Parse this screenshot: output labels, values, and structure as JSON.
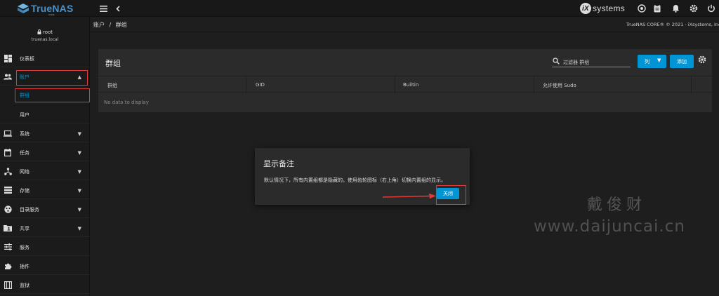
{
  "app": {
    "logo_text": "TrueNAS",
    "logo_sub": "CORE",
    "brand": "systems",
    "copyright": "TrueNAS CORE® © 2021 - iXsystems, Inc."
  },
  "icons": {
    "menu": "hamburger-menu-icon",
    "back": "chevron-left-icon",
    "topbar": [
      "truecommand-icon",
      "clipboard-icon",
      "bell-icon",
      "gear-icon",
      "power-icon"
    ]
  },
  "sidebar": {
    "user": "root",
    "host": "truenas.local",
    "items": [
      {
        "label": "仪表板",
        "icon": "dashboard-icon"
      },
      {
        "label": "账户",
        "icon": "accounts-icon",
        "expanded": true
      },
      {
        "label": "群组",
        "sub": true,
        "active": true
      },
      {
        "label": "用户",
        "sub": true
      },
      {
        "label": "系统",
        "icon": "laptop-icon"
      },
      {
        "label": "任务",
        "icon": "calendar-icon"
      },
      {
        "label": "网络",
        "icon": "network-icon"
      },
      {
        "label": "存储",
        "icon": "storage-icon"
      },
      {
        "label": "目录服务",
        "icon": "directory-icon"
      },
      {
        "label": "共享",
        "icon": "folder-share-icon"
      },
      {
        "label": "服务",
        "icon": "tune-icon"
      },
      {
        "label": "插件",
        "icon": "puzzle-icon"
      },
      {
        "label": "监狱",
        "icon": "jail-icon"
      }
    ]
  },
  "breadcrumb": {
    "parent": "账户",
    "separator": "/",
    "current": "群组"
  },
  "card": {
    "title": "群组",
    "filter_placeholder": "过滤器 群组",
    "columns_button": "列",
    "add_button": "添加",
    "columns": [
      "群组",
      "GID",
      "Builtin",
      "允许使用 Sudo"
    ],
    "empty_text": "No data to display"
  },
  "dialog": {
    "title": "显示备注",
    "message": "默认情况下，所有内置组都是隐藏的。使用齿轮图标（右上角）切换内置组的显示。",
    "close_button": "关闭"
  },
  "watermark": {
    "name": "戴俊财",
    "url": "www.daijuncai.cn"
  },
  "colors": {
    "accent": "#0095d5",
    "highlight": "#e03a3a",
    "logo": "#4c90c4"
  }
}
